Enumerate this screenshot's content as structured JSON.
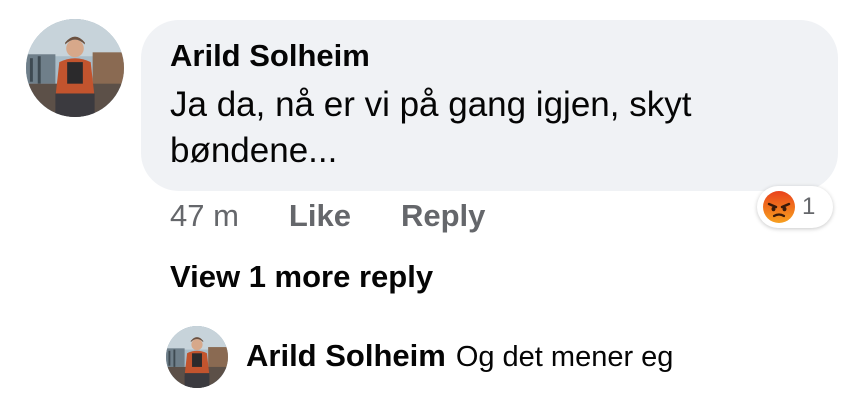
{
  "comment": {
    "author": "Arild Solheim",
    "text": "Ja da, nå er vi på gang igjen, skyt bøndene...",
    "time": "47 m",
    "like_label": "Like",
    "reply_label": "Reply",
    "reaction": {
      "icon": "angry-reaction-icon",
      "count": "1"
    }
  },
  "view_more_label": "View 1 more reply",
  "reply": {
    "author": "Arild Solheim",
    "text": "Og det mener eg"
  },
  "colors": {
    "bubble": "#f0f2f5",
    "secondary_text": "#65676b",
    "primary_text": "#050505",
    "angry_orange": "#f05b1e"
  }
}
